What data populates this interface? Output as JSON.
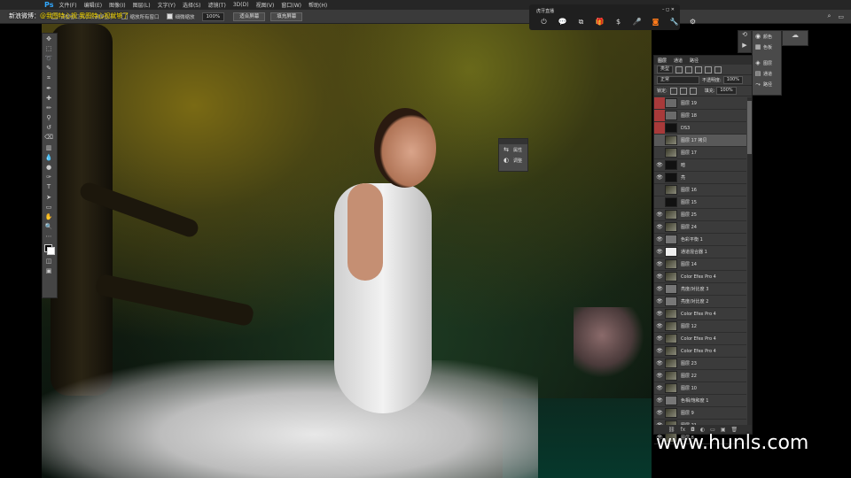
{
  "watermark_top": {
    "prefix": "新浪微博：",
    "highlight": "@我图特心视 我图特心视就够了",
    "suffix": ""
  },
  "menu": [
    "文件(F)",
    "编辑(E)",
    "图像(I)",
    "图层(L)",
    "文字(Y)",
    "选择(S)",
    "滤镜(T)",
    "3D(D)",
    "视图(V)",
    "窗口(W)",
    "帮助(H)"
  ],
  "options": {
    "left_text": "缩放所有窗口",
    "fit_label": "细微缩放",
    "zoom": "100%",
    "fit_screen": "适合屏幕",
    "fill_screen": "填充屏幕",
    "show_all": "调整窗口大小以满屏显示"
  },
  "recorder": {
    "title": "虎牙直播",
    "controls": "– ◻ ✕"
  },
  "mini_panel": {
    "items": [
      {
        "icon": "⇆",
        "label": "属性"
      },
      {
        "icon": "◐",
        "label": "调整"
      }
    ]
  },
  "right_panel": {
    "items": [
      {
        "icon": "◉",
        "label": "颜色"
      },
      {
        "icon": "▦",
        "label": "色板"
      }
    ],
    "items2": [
      {
        "icon": "◈",
        "label": "图层"
      },
      {
        "icon": "▤",
        "label": "通道"
      },
      {
        "icon": "⤳",
        "label": "路径"
      }
    ]
  },
  "layers_panel": {
    "tabs": [
      "图层",
      "通道",
      "路径"
    ],
    "kind_filter": "类型",
    "blend_mode": "正常",
    "opacity_label": "不透明度:",
    "opacity": "100%",
    "lock_label": "锁定:",
    "fill_label": "填充:",
    "fill": "100%",
    "layers": [
      {
        "name": "图层 19",
        "thumb": "grey",
        "eye": "red"
      },
      {
        "name": "图层 18",
        "thumb": "grey",
        "eye": "red"
      },
      {
        "name": "DS3",
        "thumb": "mask",
        "eye": "red"
      },
      {
        "name": "图层 17 拷贝",
        "thumb": "photo",
        "eye": "",
        "selected": true
      },
      {
        "name": "图层 17",
        "thumb": "photo",
        "eye": ""
      },
      {
        "name": "暗",
        "thumb": "mask",
        "eye": "👁"
      },
      {
        "name": "亮",
        "thumb": "mask",
        "eye": "👁"
      },
      {
        "name": "图层 16",
        "thumb": "photo",
        "eye": ""
      },
      {
        "name": "图层 15",
        "thumb": "mask",
        "eye": ""
      },
      {
        "name": "图层 25",
        "thumb": "photo",
        "eye": "👁"
      },
      {
        "name": "图层 24",
        "thumb": "photo",
        "eye": "👁"
      },
      {
        "name": "色彩平衡 1",
        "thumb": "adj",
        "eye": "👁"
      },
      {
        "name": "通道混合器 1",
        "thumb": "maskw",
        "eye": "👁"
      },
      {
        "name": "图层 14",
        "thumb": "photo",
        "eye": "👁"
      },
      {
        "name": "Color Efex Pro 4",
        "thumb": "photo",
        "eye": "👁"
      },
      {
        "name": "亮度/对比度 3",
        "thumb": "adj",
        "eye": "👁"
      },
      {
        "name": "亮度/对比度 2",
        "thumb": "adj",
        "eye": "👁"
      },
      {
        "name": "Color Efex Pro 4",
        "thumb": "photo",
        "eye": "👁"
      },
      {
        "name": "图层 12",
        "thumb": "photo",
        "eye": "👁"
      },
      {
        "name": "Color Efex Pro 4",
        "thumb": "photo",
        "eye": "👁"
      },
      {
        "name": "Color Efex Pro 4",
        "thumb": "photo",
        "eye": "👁"
      },
      {
        "name": "图层 23",
        "thumb": "photo",
        "eye": "👁"
      },
      {
        "name": "图层 22",
        "thumb": "photo",
        "eye": "👁"
      },
      {
        "name": "图层 10",
        "thumb": "photo",
        "eye": "👁"
      },
      {
        "name": "色相/饱和度 1",
        "thumb": "adj",
        "eye": "👁"
      },
      {
        "name": "图层 9",
        "thumb": "photo",
        "eye": "👁"
      },
      {
        "name": "图层 21",
        "thumb": "photo",
        "eye": "👁"
      },
      {
        "name": "图层 8",
        "thumb": "photo",
        "eye": "👁"
      }
    ],
    "bottom_icons": [
      "⛓",
      "fx",
      "◘",
      "◐",
      "▭",
      "▣",
      "🗑"
    ]
  },
  "site_watermark": "www.hunls.com"
}
